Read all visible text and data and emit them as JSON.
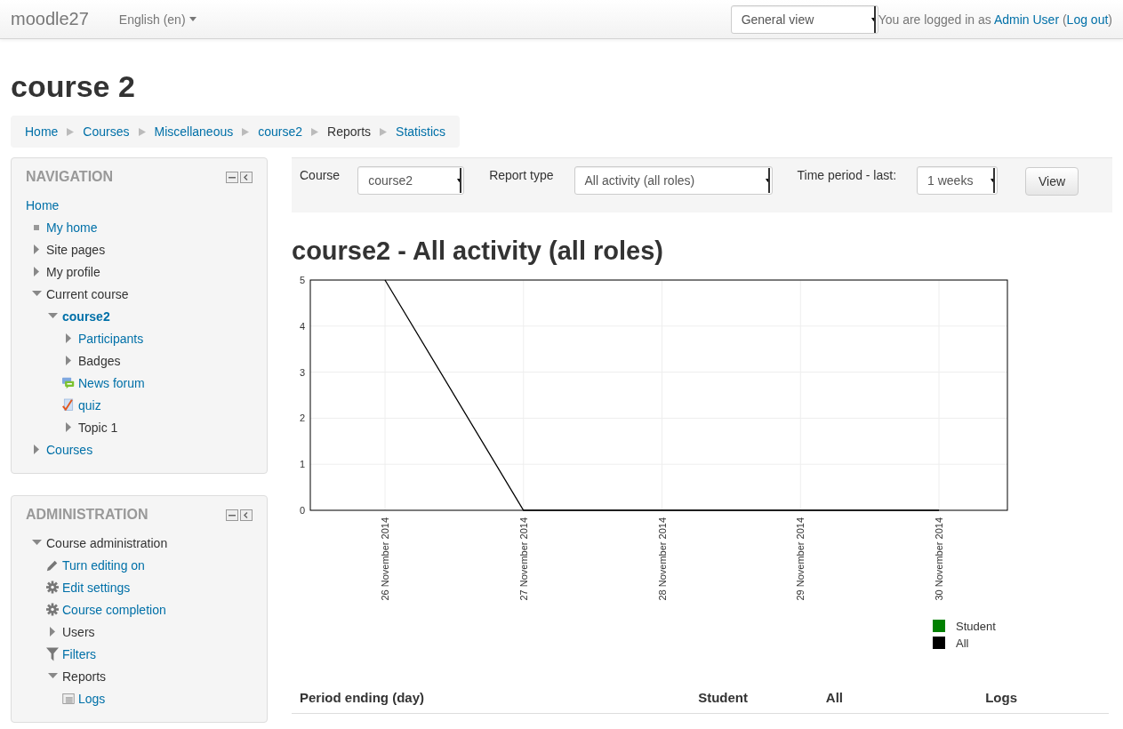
{
  "header": {
    "site_name": "moodle27",
    "language": "English (en)",
    "view_select": "General view",
    "login": {
      "prefix": "You are logged in as",
      "user": "Admin User",
      "open_paren": "(",
      "logout": "Log out",
      "close_paren": ")"
    }
  },
  "page_title": "course 2",
  "breadcrumb": [
    {
      "label": "Home",
      "link": true
    },
    {
      "label": "Courses",
      "link": true
    },
    {
      "label": "Miscellaneous",
      "link": true
    },
    {
      "label": "course2",
      "link": true
    },
    {
      "label": "Reports",
      "link": false
    },
    {
      "label": "Statistics",
      "link": true
    }
  ],
  "blocks": [
    {
      "title": "NAVIGATION",
      "items": [
        {
          "label": "Home",
          "kind": "root",
          "link": true,
          "current": false,
          "children": [
            {
              "label": "My home",
              "kind": "bullet",
              "link": true,
              "current": false
            },
            {
              "label": "Site pages",
              "kind": "branch",
              "expanded": false,
              "link": false,
              "current": false
            },
            {
              "label": "My profile",
              "kind": "branch",
              "expanded": false,
              "link": false,
              "current": false
            },
            {
              "label": "Current course",
              "kind": "branch",
              "expanded": true,
              "link": false,
              "current": false,
              "children": [
                {
                  "label": "course2",
                  "kind": "branch",
                  "expanded": true,
                  "link": true,
                  "current": true,
                  "children": [
                    {
                      "label": "Participants",
                      "kind": "branch",
                      "expanded": false,
                      "link": true,
                      "current": false
                    },
                    {
                      "label": "Badges",
                      "kind": "branch",
                      "expanded": false,
                      "link": false,
                      "current": false
                    },
                    {
                      "label": "News forum",
                      "kind": "forum",
                      "link": true,
                      "current": false
                    },
                    {
                      "label": "quiz",
                      "kind": "quiz",
                      "link": true,
                      "current": false
                    },
                    {
                      "label": "Topic 1",
                      "kind": "branch",
                      "expanded": false,
                      "link": false,
                      "current": false
                    }
                  ]
                }
              ]
            },
            {
              "label": "Courses",
              "kind": "branch",
              "expanded": false,
              "link": true,
              "current": false
            }
          ]
        }
      ]
    },
    {
      "title": "ADMINISTRATION",
      "items": [
        {
          "label": "Course administration",
          "kind": "branch",
          "expanded": true,
          "link": false,
          "current": false,
          "children": [
            {
              "label": "Turn editing on",
              "kind": "edit",
              "link": true,
              "current": false
            },
            {
              "label": "Edit settings",
              "kind": "settings",
              "link": true,
              "current": false
            },
            {
              "label": "Course completion",
              "kind": "settings",
              "link": true,
              "current": false
            },
            {
              "label": "Users",
              "kind": "branch",
              "expanded": false,
              "link": false,
              "current": false
            },
            {
              "label": "Filters",
              "kind": "filter",
              "link": true,
              "current": false
            },
            {
              "label": "Reports",
              "kind": "branch",
              "expanded": true,
              "link": false,
              "current": false,
              "children": [
                {
                  "label": "Logs",
                  "kind": "report",
                  "link": true,
                  "current": false
                }
              ]
            }
          ]
        }
      ]
    }
  ],
  "filters": [
    {
      "label": "Course",
      "value": "course2",
      "kind": "select"
    },
    {
      "label": "Report type",
      "value": "All activity (all roles)",
      "kind": "select"
    },
    {
      "label": "Time period - last:",
      "value": "1 weeks",
      "kind": "select"
    }
  ],
  "view_button": "View",
  "report_title": "course2 - All activity (all roles)",
  "chart": {
    "chart_data": {
      "type": "line",
      "categories": [
        "26 November 2014",
        "27 November 2014",
        "28 November 2014",
        "29 November 2014",
        "30 November 2014"
      ],
      "ylim": [
        0,
        5
      ],
      "grid": true,
      "legend": true,
      "yticks": [
        0,
        1,
        2,
        3,
        4,
        5
      ],
      "series": [
        {
          "name": "Student",
          "color": "#008000",
          "values": [
            null,
            null,
            null,
            null,
            null
          ]
        },
        {
          "name": "All",
          "color": "#000000",
          "values": [
            5,
            0,
            0,
            0,
            0
          ]
        }
      ]
    }
  },
  "table": {
    "columns": [
      "Period ending (day)",
      "Student",
      "All",
      "Logs"
    ]
  }
}
